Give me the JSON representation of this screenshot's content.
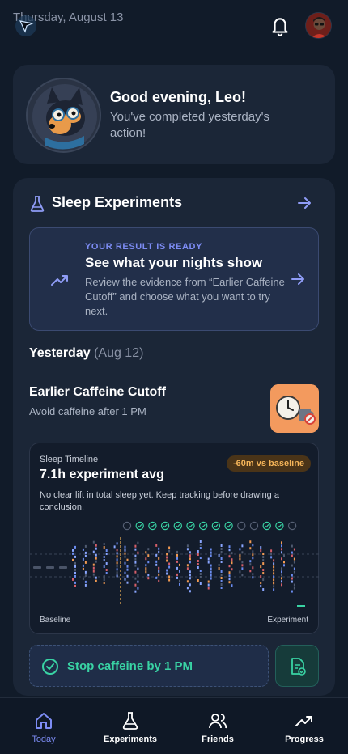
{
  "header": {
    "date": "Thursday, August 13",
    "logo_icon": "cursor-logo-icon",
    "notification_icon": "bell-icon"
  },
  "greeting": {
    "title": "Good evening, Leo!",
    "subtitle": "You've completed yesterday's action!"
  },
  "experiments": {
    "title": "Sleep Experiments",
    "result": {
      "kicker": "YOUR RESULT IS READY",
      "title": "See what your nights show",
      "body": "Review the evidence from “Earlier Caffeine Cutoff” and choose what you want to try next."
    },
    "yesterday_label": "Yesterday",
    "yesterday_date": "(Aug 12)",
    "action": {
      "title": "Earlier Caffeine Cutoff",
      "subtitle": "Avoid caffeine after 1 PM"
    },
    "timeline": {
      "label": "Sleep Timeline",
      "value": "7.1h experiment avg",
      "badge": "-60m vs baseline",
      "note": "No clear lift in total sleep yet. Keep tracking before drawing a conclusion.",
      "baseline_label": "Baseline",
      "experiment_label": "Experiment",
      "checkins": [
        false,
        true,
        true,
        true,
        true,
        true,
        true,
        true,
        true,
        false,
        false,
        true,
        true,
        false
      ]
    },
    "stop_button": "Stop caffeine by 1 PM"
  },
  "colors": {
    "accent": "#7d8cf4",
    "success": "#39d3a4",
    "warning": "#f5b559",
    "card": "#1b2637",
    "background": "#111b29"
  },
  "nav": {
    "items": [
      {
        "label": "Today",
        "icon": "home-icon",
        "active": true
      },
      {
        "label": "Experiments",
        "icon": "flask-icon",
        "active": false
      },
      {
        "label": "Friends",
        "icon": "users-icon",
        "active": false
      },
      {
        "label": "Progress",
        "icon": "trending-up-icon",
        "active": false
      }
    ]
  }
}
